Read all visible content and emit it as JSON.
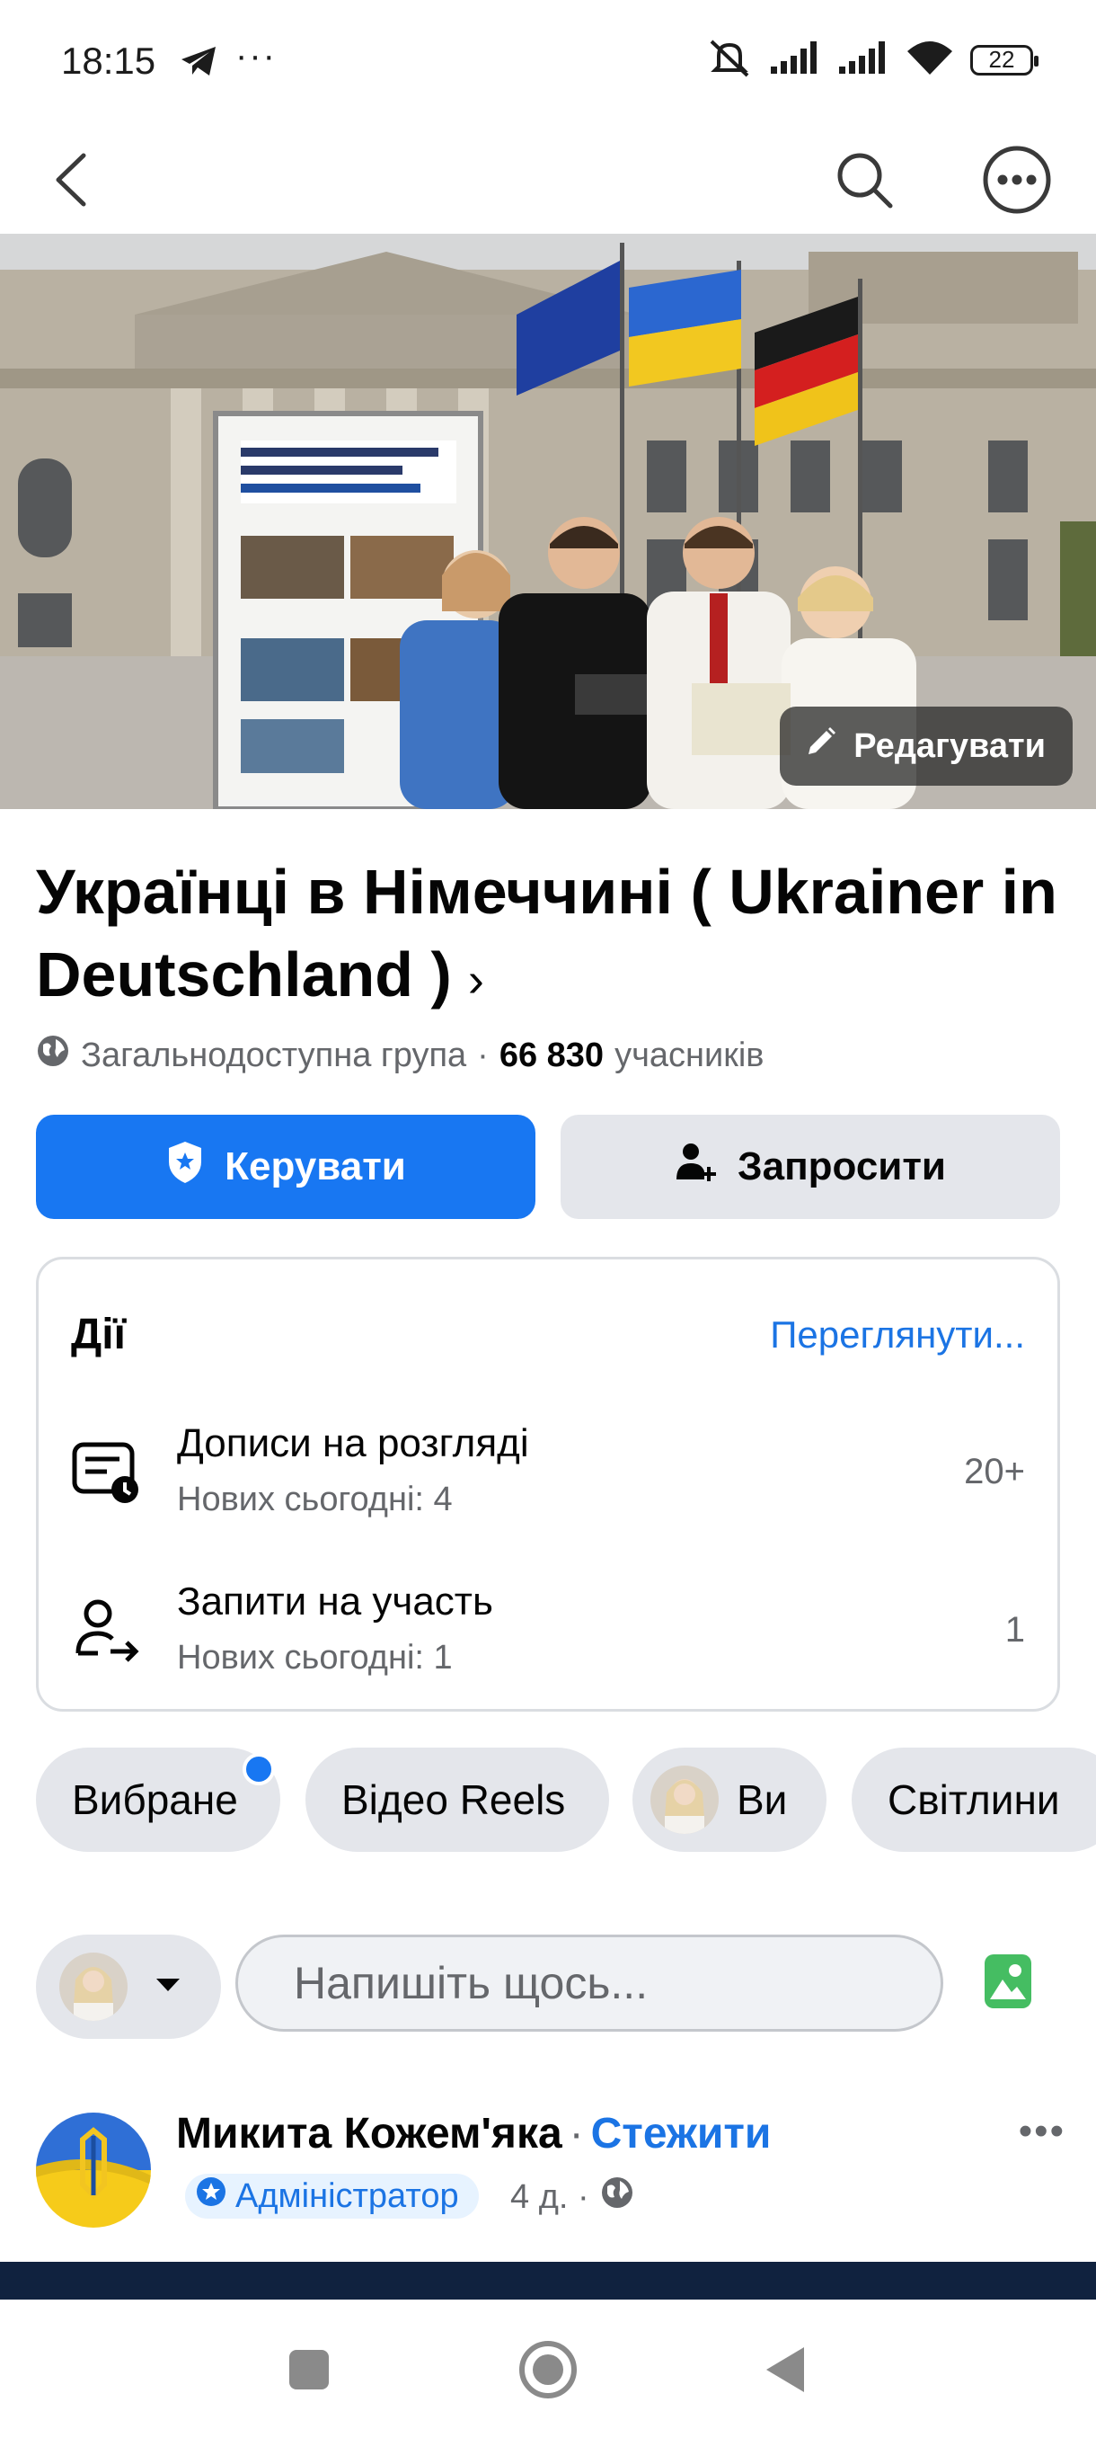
{
  "status_bar": {
    "time": "18:15",
    "dots": "···",
    "battery": "22"
  },
  "cover": {
    "edit_label": "Редагувати"
  },
  "group": {
    "title": "Українці в Німеччині ( Ukrainer in Deutschland )",
    "chevron": "›",
    "privacy": "Загальнодоступна група",
    "separator": "·",
    "members_count": "66 830",
    "members_label": "учасників"
  },
  "buttons": {
    "manage": "Керувати",
    "invite": "Запросити"
  },
  "actions_card": {
    "title": "Дії",
    "view_link": "Переглянути...",
    "rows": [
      {
        "title": "Дописи на розгляді",
        "subtitle": "Нових сьогодні: 4",
        "count": "20+"
      },
      {
        "title": "Запити на участь",
        "subtitle": "Нових сьогодні: 1",
        "count": "1"
      }
    ]
  },
  "chips": [
    {
      "label": "Вибране"
    },
    {
      "label": "Відео Reels"
    },
    {
      "label": "Ви"
    },
    {
      "label": "Світлини"
    }
  ],
  "composer": {
    "placeholder": "Напишіть щось..."
  },
  "post": {
    "author": "Микита Кожем'яка",
    "separator": "·",
    "follow": "Стежити",
    "badge": "Адміністратор",
    "time": "4 д. ·",
    "more": "•••"
  },
  "colors": {
    "primary": "#1877f2",
    "link": "#1b74e4",
    "chip_bg": "#e4e6eb",
    "secondary_text": "#65676b"
  }
}
